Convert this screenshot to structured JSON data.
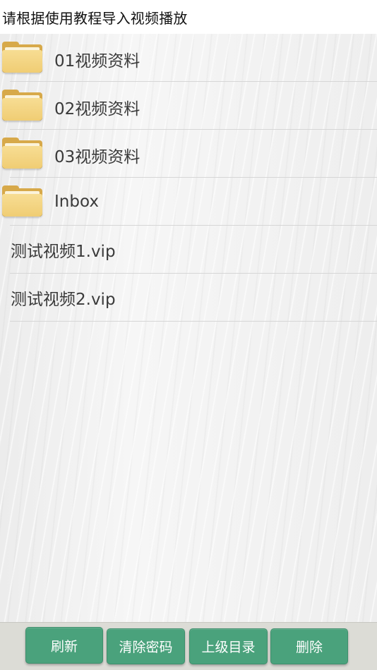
{
  "header": {
    "title": "请根据使用教程导入视频播放"
  },
  "list": {
    "folders": [
      {
        "label": "01视频资料",
        "icon": "folder-icon"
      },
      {
        "label": "02视频资料",
        "icon": "folder-icon"
      },
      {
        "label": "03视频资料",
        "icon": "folder-icon"
      },
      {
        "label": "Inbox",
        "icon": "folder-icon"
      }
    ],
    "files": [
      {
        "label": "测试视频1.vip"
      },
      {
        "label": "测试视频2.vip"
      }
    ]
  },
  "toolbar": {
    "refresh_label": "刷新",
    "clear_password_label": "清除密码",
    "parent_dir_label": "上级目录",
    "delete_label": "删除"
  },
  "colors": {
    "button": "#4aa27c",
    "bottom_bar": "#dcdcd6",
    "folder": "#f0cd74"
  }
}
